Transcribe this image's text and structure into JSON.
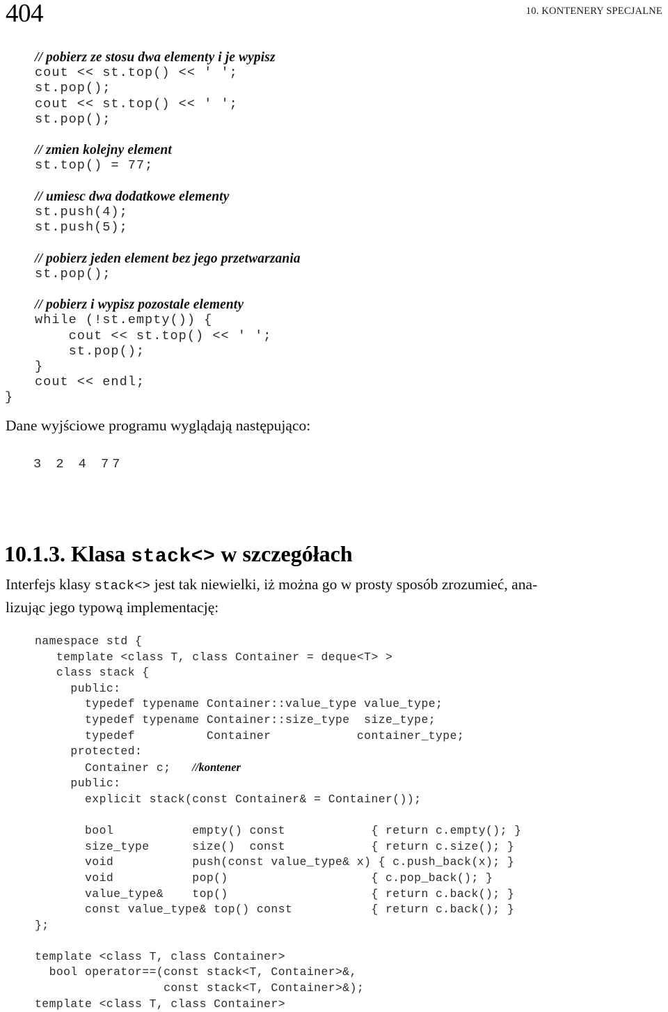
{
  "page": {
    "folio": "404",
    "running_head": "10. KONTENERY SPECJALNE"
  },
  "code_block_1": {
    "lines": [
      {
        "type": "comment",
        "text": "// pobierz ze stosu dwa elementy i je wypisz"
      },
      {
        "type": "code",
        "text": "cout << st.top() << ' ';"
      },
      {
        "type": "code",
        "text": "st.pop();"
      },
      {
        "type": "code",
        "text": "cout << st.top() << ' ';"
      },
      {
        "type": "code",
        "text": "st.pop();"
      },
      {
        "type": "blank",
        "text": ""
      },
      {
        "type": "comment",
        "text": "// zmien kolejny element"
      },
      {
        "type": "code",
        "text": "st.top() = 77;"
      },
      {
        "type": "blank",
        "text": ""
      },
      {
        "type": "comment",
        "text": "// umiesc dwa dodatkowe elementy"
      },
      {
        "type": "code",
        "text": "st.push(4);"
      },
      {
        "type": "code",
        "text": "st.push(5);"
      },
      {
        "type": "blank",
        "text": ""
      },
      {
        "type": "comment",
        "text": "// pobierz jeden element bez jego przetwarzania"
      },
      {
        "type": "code",
        "text": "st.pop();"
      },
      {
        "type": "blank",
        "text": ""
      },
      {
        "type": "comment",
        "text": "// pobierz i wypisz pozostale elementy"
      },
      {
        "type": "code",
        "text": "while (!st.empty()) {"
      },
      {
        "type": "code",
        "text": "    cout << st.top() << ' ';"
      },
      {
        "type": "code",
        "text": "    st.pop();"
      },
      {
        "type": "code",
        "text": "}"
      },
      {
        "type": "code",
        "text": "cout << endl;"
      },
      {
        "type": "code-dedent",
        "text": "}"
      }
    ]
  },
  "output_intro": {
    "text": "Dane wyjściowe programu wyglądają następująco:"
  },
  "program_output": {
    "text": "3 2 4 77"
  },
  "section_heading": {
    "number": "10.1.3.",
    "title_before": " Klasa ",
    "code": "stack<>",
    "title_after": " w szczegółach"
  },
  "intro_paragraph": {
    "line1_a": "Interfejs klasy ",
    "line1_code": "stack<>",
    "line1_b": " jest tak niewielki, iż można go w prosty sposób zrozumieć, ana-",
    "line2": "lizując jego typową implementację:"
  },
  "code_block_2": {
    "lines": [
      {
        "type": "code",
        "text": "namespace std {"
      },
      {
        "type": "code",
        "text": "   template <class T, class Container = deque<T> >"
      },
      {
        "type": "code",
        "text": "   class stack {"
      },
      {
        "type": "code",
        "text": "     public:"
      },
      {
        "type": "code",
        "text": "       typedef typename Container::value_type value_type;"
      },
      {
        "type": "code",
        "text": "       typedef typename Container::size_type  size_type;"
      },
      {
        "type": "code",
        "text": "       typedef          Container            container_type;"
      },
      {
        "type": "code",
        "text": "     protected:"
      },
      {
        "type": "code-comment",
        "code": "       Container c;   ",
        "comment": "//kontener"
      },
      {
        "type": "code",
        "text": "     public:"
      },
      {
        "type": "code",
        "text": "       explicit stack(const Container& = Container());"
      },
      {
        "type": "blank",
        "text": ""
      },
      {
        "type": "code",
        "text": "       bool           empty() const            { return c.empty(); }"
      },
      {
        "type": "code",
        "text": "       size_type      size()  const            { return c.size(); }"
      },
      {
        "type": "code",
        "text": "       void           push(const value_type& x) { c.push_back(x); }"
      },
      {
        "type": "code",
        "text": "       void           pop()                    { c.pop_back(); }"
      },
      {
        "type": "code",
        "text": "       value_type&    top()                    { return c.back(); }"
      },
      {
        "type": "code",
        "text": "       const value_type& top() const           { return c.back(); }"
      },
      {
        "type": "code",
        "text": "};"
      },
      {
        "type": "blank",
        "text": ""
      },
      {
        "type": "code",
        "text": "template <class T, class Container>"
      },
      {
        "type": "code",
        "text": "  bool operator==(const stack<T, Container>&,"
      },
      {
        "type": "code",
        "text": "                  const stack<T, Container>&);"
      },
      {
        "type": "code",
        "text": "template <class T, class Container>"
      }
    ]
  }
}
